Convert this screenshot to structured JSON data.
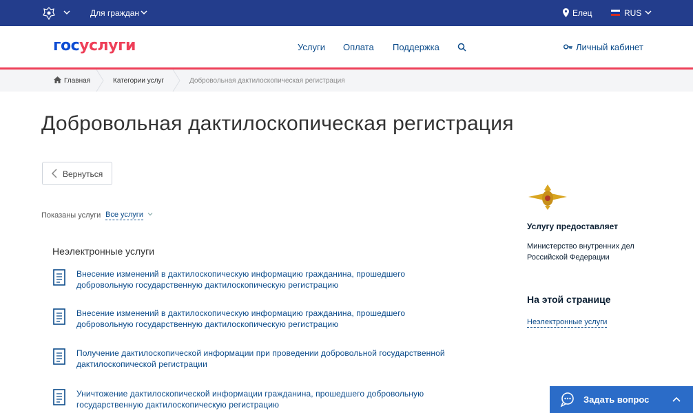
{
  "topbar": {
    "citizens_label": "Для граждан",
    "city": "Елец",
    "language": "RUS"
  },
  "header": {
    "logo_part1": "гос",
    "logo_part2": "услуги",
    "nav": [
      "Услуги",
      "Оплата",
      "Поддержка"
    ],
    "cabinet_label": "Личный кабинет"
  },
  "breadcrumb": {
    "home": "Главная",
    "category": "Категории услуг",
    "current": "Добровольная дактилоскопическая регистрация"
  },
  "page": {
    "title": "Добровольная дактилоскопическая регистрация",
    "back_label": "Вернуться",
    "shown_label": "Показаны услуги",
    "filter_value": "Все услуги",
    "section_title": "Неэлектронные услуги",
    "services": [
      {
        "line1": "Внесение изменений в дактилоскопическую информацию гражданина, прошедшего",
        "line2": "добровольную государственную дактилоскопическую регистрацию"
      },
      {
        "line1": "Внесение изменений в дактилоскопическую информацию гражданина, прошедшего",
        "line2": "добровольную государственную дактилоскопическую регистрацию"
      },
      {
        "line1": "Получение дактилоскопической информации при проведении добровольной государственной",
        "line2": "дактилоскопической регистрации"
      },
      {
        "line1": "Уничтожение дактилоскопической информации гражданина, прошедшего добровольную",
        "line2": "государственную дактилоскопическую регистрацию"
      }
    ]
  },
  "sidebar": {
    "provider_heading": "Услугу предоставляет",
    "agency_line1": "Министерство внутренних дел",
    "agency_line2": "Российской Федерации",
    "toc_heading": "На этой странице",
    "toc_link": "Неэлектронные услуги"
  },
  "ask_widget": {
    "label": "Задать вопрос"
  },
  "colors": {
    "topbar": "#233d8c",
    "accent_red": "#ee3f58",
    "logo_blue": "#0d4cd3",
    "link": "#0b4b8a",
    "ask_button": "#2b6cc8"
  }
}
